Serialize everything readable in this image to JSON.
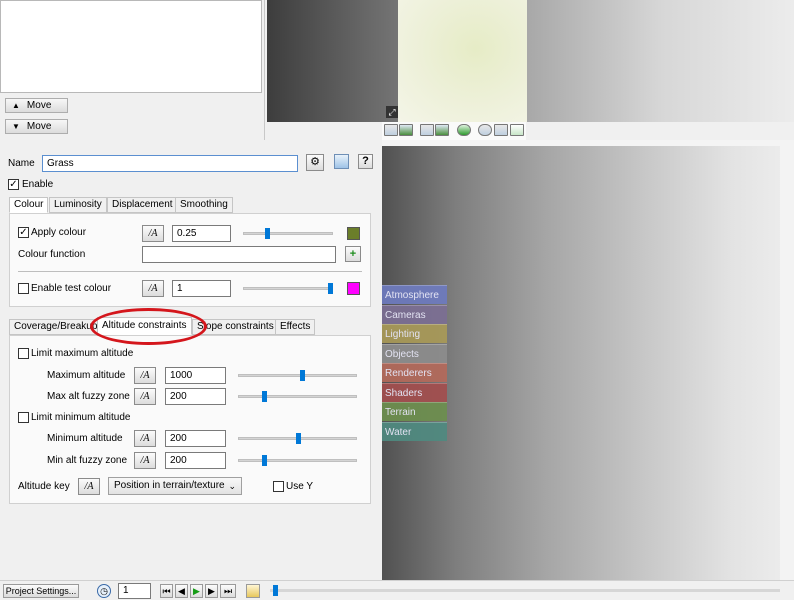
{
  "top_list": {
    "move_up_label": "Move",
    "move_down_label": "Move",
    "up_arrow": "▲",
    "down_arrow": "▼"
  },
  "node": {
    "name_label": "Name",
    "name_value": "Grass",
    "enable_label": "Enable",
    "help_label": "?",
    "gear_icon": "gear-icon",
    "tabs": [
      {
        "label": "Colour",
        "active": true
      },
      {
        "label": "Luminosity"
      },
      {
        "label": "Displacement"
      },
      {
        "label": "Smoothing"
      }
    ],
    "apply_colour_label": "Apply colour",
    "apply_colour_value": "0.25",
    "apply_colour_swatch": "#6b7e2a",
    "colour_function_label": "Colour function",
    "enable_test_colour_label": "Enable test colour",
    "test_colour_value": "1",
    "test_colour_swatch": "#ff00ff",
    "subtabs": [
      {
        "label": "Coverage/Breakup"
      },
      {
        "label": "Altitude constraints",
        "active": true
      },
      {
        "label": "Slope constraints"
      },
      {
        "label": "Effects"
      }
    ],
    "limit_max_label": "Limit maximum altitude",
    "max_alt_label": "Maximum altitude",
    "max_alt_value": "1000",
    "max_fuzzy_label": "Max alt fuzzy zone",
    "max_fuzzy_value": "200",
    "limit_min_label": "Limit minimum altitude",
    "min_alt_label": "Minimum altitude",
    "min_alt_value": "200",
    "min_fuzzy_label": "Min alt fuzzy zone",
    "min_fuzzy_value": "200",
    "altitude_key_label": "Altitude key",
    "altitude_key_value": "Position in terrain/texture",
    "use_y_label": "Use Y",
    "fn_button_glyph": "/A",
    "highlight_color": "#d4161c"
  },
  "categories": [
    {
      "label": "Atmosphere",
      "color": "#6e7bbf"
    },
    {
      "label": "Cameras",
      "color": "#7c6f94"
    },
    {
      "label": "Lighting",
      "color": "#a99a58"
    },
    {
      "label": "Objects",
      "color": "#8d8d8d"
    },
    {
      "label": "Renderers",
      "color": "#b46a5b"
    },
    {
      "label": "Shaders",
      "color": "#a34e4e"
    },
    {
      "label": "Terrain",
      "color": "#6d8f4e"
    },
    {
      "label": "Water",
      "color": "#4f8a80"
    }
  ],
  "bottom": {
    "project_settings_label": "Project Settings...",
    "frame_value": "1",
    "clock_icon": "clock-icon"
  }
}
